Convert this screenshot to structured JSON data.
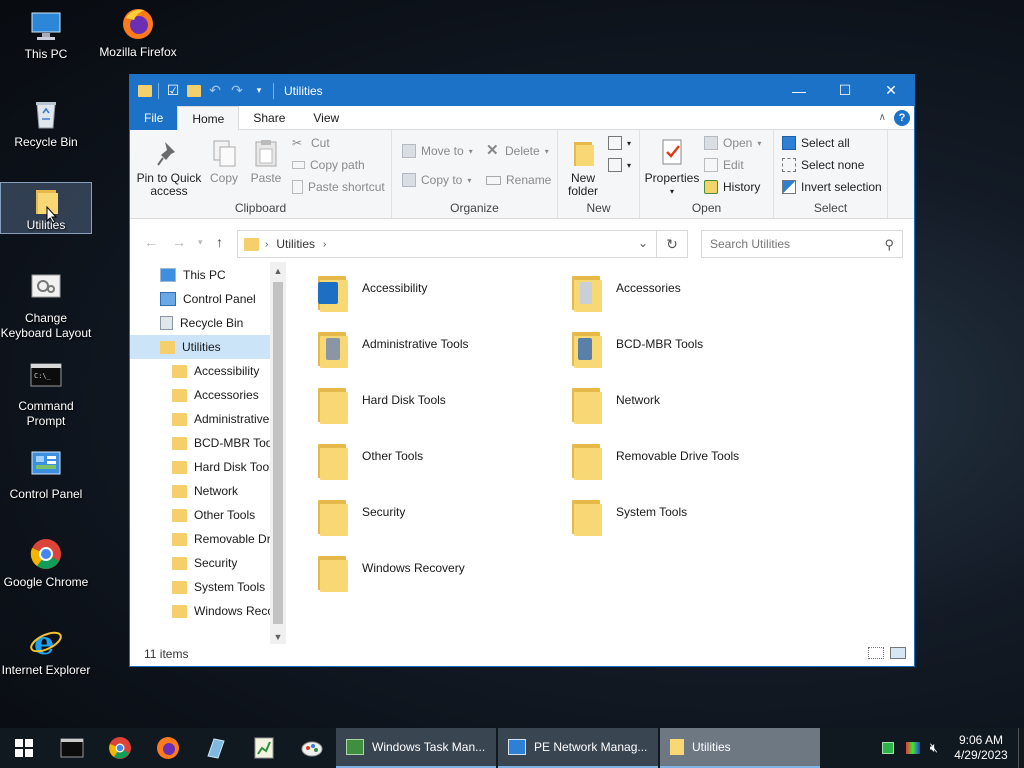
{
  "desktop": {
    "icons": [
      {
        "label": "This PC"
      },
      {
        "label": "Mozilla Firefox"
      },
      {
        "label": "Recycle Bin"
      },
      {
        "label": "Utilities"
      },
      {
        "label": "Change Keyboard Layout"
      },
      {
        "label": "Command Prompt"
      },
      {
        "label": "Control Panel"
      },
      {
        "label": "Google Chrome"
      },
      {
        "label": "Internet Explorer"
      }
    ]
  },
  "window": {
    "title": "Utilities",
    "controls": {
      "minimize": "—",
      "maximize": "☐",
      "close": "✕"
    },
    "tabs": [
      "File",
      "Home",
      "Share",
      "View"
    ],
    "help": "?",
    "ribbon": {
      "clipboard": {
        "label": "Clipboard",
        "pin_line1": "Pin to Quick",
        "pin_line2": "access",
        "copy": "Copy",
        "paste": "Paste",
        "cut": "Cut",
        "copy_path": "Copy path",
        "paste_shortcut": "Paste shortcut"
      },
      "organize": {
        "label": "Organize",
        "move_to": "Move to",
        "copy_to": "Copy to",
        "delete": "Delete",
        "rename": "Rename"
      },
      "new": {
        "label": "New",
        "new_folder_line1": "New",
        "new_folder_line2": "folder"
      },
      "open": {
        "label": "Open",
        "properties": "Properties",
        "open": "Open",
        "edit": "Edit",
        "history": "History"
      },
      "select": {
        "label": "Select",
        "select_all": "Select all",
        "select_none": "Select none",
        "invert_selection": "Invert selection"
      }
    },
    "address": {
      "crumb": "Utilities",
      "search_placeholder": "Search Utilities"
    },
    "nav": [
      "This PC",
      "Control Panel",
      "Recycle Bin",
      "Utilities",
      "Accessibility",
      "Accessories",
      "Administrative Tools",
      "BCD-MBR Tools",
      "Hard Disk Tools",
      "Network",
      "Other Tools",
      "Removable Drive Tools",
      "Security",
      "System Tools",
      "Windows Recovery"
    ],
    "items": [
      "Accessibility",
      "Accessories",
      "Administrative Tools",
      "BCD-MBR Tools",
      "Hard Disk Tools",
      "Network",
      "Other Tools",
      "Removable Drive Tools",
      "Security",
      "System Tools",
      "Windows Recovery"
    ],
    "status": "11 items"
  },
  "taskbar": {
    "tasks": [
      "Windows Task Man...",
      "PE Network Manag...",
      "Utilities"
    ],
    "clock_time": "9:06 AM",
    "clock_date": "4/29/2023"
  },
  "colors": {
    "accent": "#1c72c7",
    "folder": "#f8d775",
    "taskbar": "#101820"
  }
}
